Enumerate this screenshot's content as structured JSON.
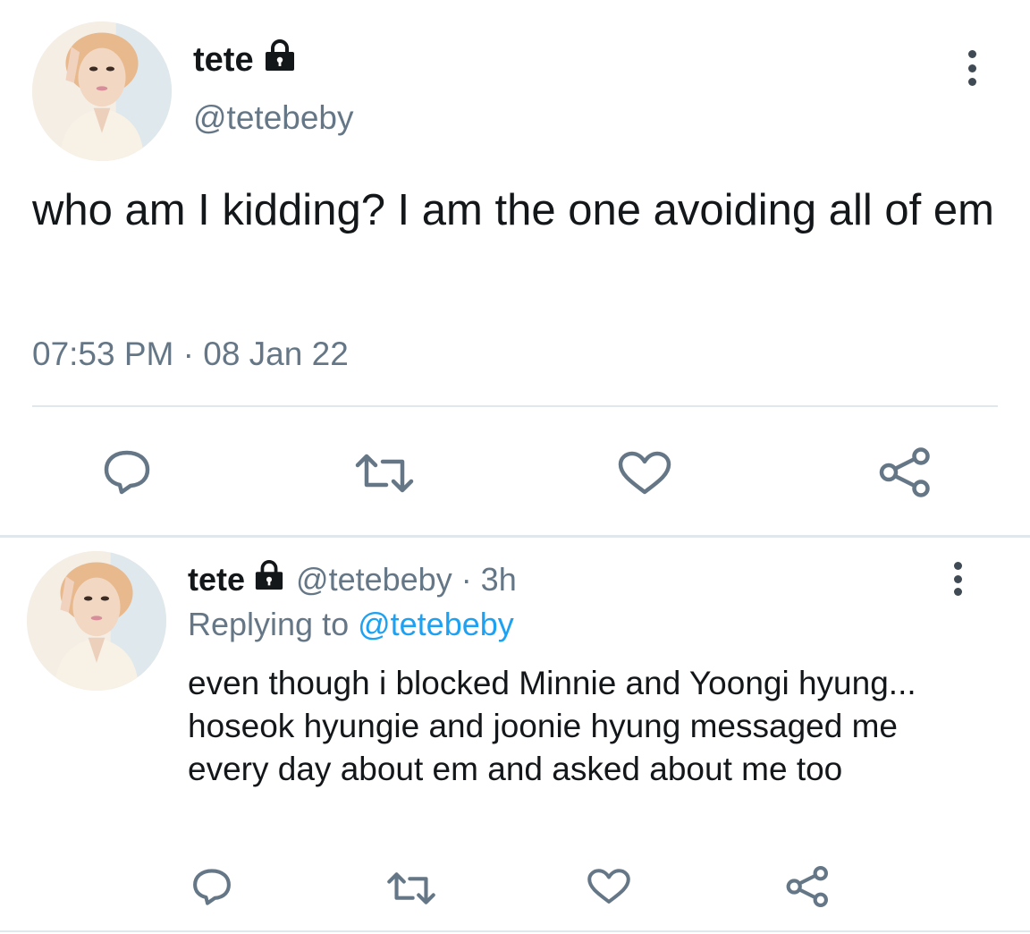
{
  "main_tweet": {
    "author": {
      "display_name": "tete",
      "handle": "@tetebeby",
      "protected_icon": "lock-icon",
      "avatar": "profile-photo"
    },
    "text": "who am I kidding? I am the one avoiding all of em",
    "timestamp": "07:53 PM · 08 Jan 22",
    "more_icon": "more-vertical-icon",
    "actions": [
      {
        "name": "reply",
        "icon": "comment-icon"
      },
      {
        "name": "retweet",
        "icon": "retweet-icon"
      },
      {
        "name": "like",
        "icon": "heart-icon"
      },
      {
        "name": "share",
        "icon": "share-icon"
      }
    ]
  },
  "reply_tweet": {
    "author": {
      "display_name": "tete",
      "handle_time": "@tetebeby · 3h",
      "protected_icon": "lock-icon",
      "avatar": "profile-photo"
    },
    "replying_prefix": "Replying to ",
    "replying_to": "@tetebeby",
    "text": "even though i blocked Minnie and Yoongi hyung... hoseok hyungie and joonie hyung messaged me every day about em and asked about me too",
    "more_icon": "more-vertical-icon",
    "actions": [
      {
        "name": "reply",
        "icon": "comment-icon"
      },
      {
        "name": "retweet",
        "icon": "retweet-icon"
      },
      {
        "name": "like",
        "icon": "heart-icon"
      },
      {
        "name": "share",
        "icon": "share-icon"
      }
    ]
  },
  "colors": {
    "text": "#14171a",
    "muted": "#657786",
    "link": "#1da1f2",
    "divider": "#e1e8ed",
    "icon": "#657786"
  }
}
